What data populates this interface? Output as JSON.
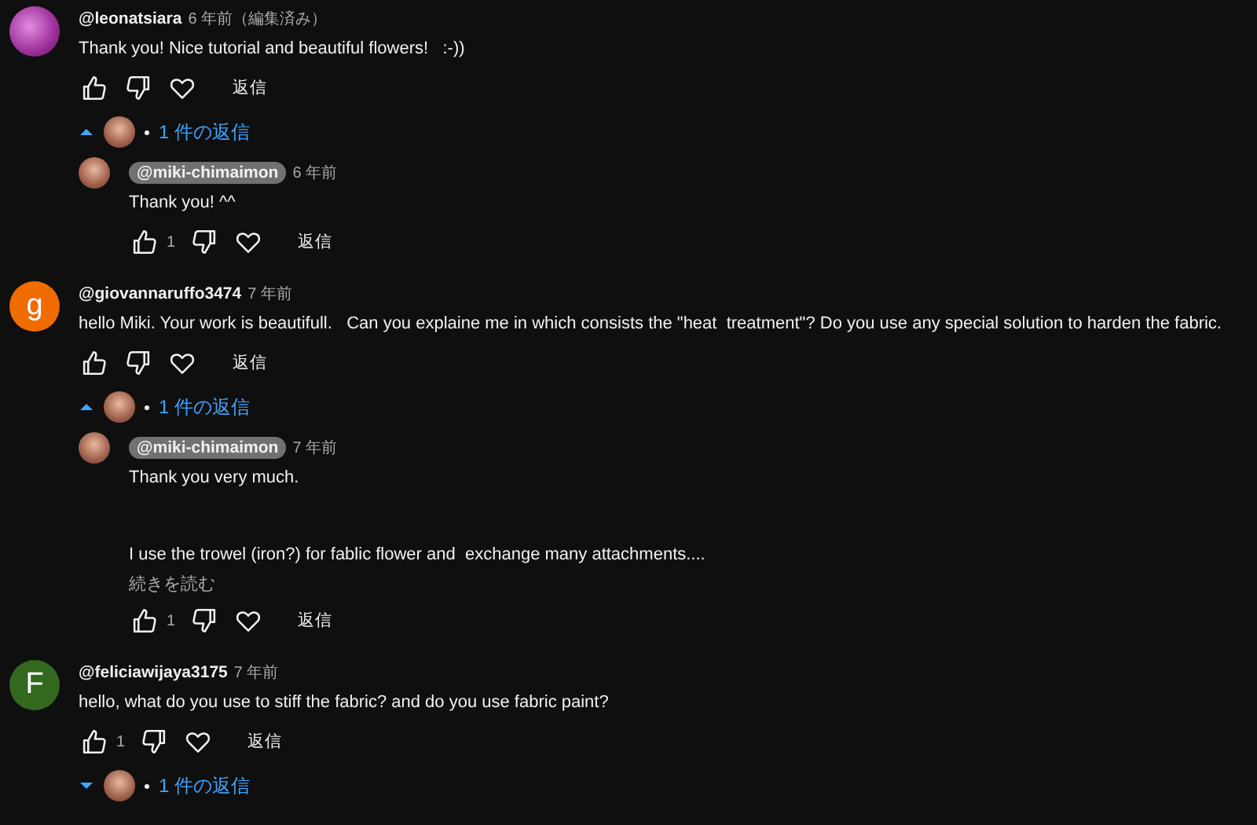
{
  "comments": [
    {
      "avatar": {
        "kind": "photo"
      },
      "author": "@leonatsiara",
      "time": "6 年前（編集済み）",
      "paragraphs": [
        "Thank you! Nice tutorial and beautiful flowers!   :-))"
      ],
      "reply_label": "返信",
      "replies_toggle": {
        "label": "1 件の返信",
        "expanded": true
      },
      "replies": [
        {
          "author": "@miki-chimaimon",
          "creator": true,
          "time": "6 年前",
          "paragraphs": [
            "Thank you! ^^"
          ],
          "likes": "1",
          "reply_label": "返信"
        }
      ]
    },
    {
      "avatar": {
        "kind": "letter",
        "letter": "g",
        "color": "#ef6c00"
      },
      "author": "@giovannaruffo3474",
      "time": "7 年前",
      "paragraphs": [
        "hello Miki. Your work is beautifull.   Can you explaine me in which consists the \"heat  treatment\"? Do you use any special solution to harden the fabric."
      ],
      "reply_label": "返信",
      "replies_toggle": {
        "label": "1 件の返信",
        "expanded": true
      },
      "replies": [
        {
          "author": "@miki-chimaimon",
          "creator": true,
          "time": "7 年前",
          "paragraphs": [
            "Thank you very much.",
            "I use the trowel (iron?) for fablic flower and  exchange many attachments...."
          ],
          "read_more": "続きを読む",
          "likes": "1",
          "reply_label": "返信"
        }
      ]
    },
    {
      "avatar": {
        "kind": "letter",
        "letter": "F",
        "color": "#33691e"
      },
      "author": "@feliciawijaya3175",
      "time": "7 年前",
      "paragraphs": [
        "hello, what do you use to stiff the fabric? and do you use fabric paint?"
      ],
      "likes": "1",
      "reply_label": "返信",
      "replies_toggle": {
        "label": "1 件の返信",
        "expanded": false
      }
    }
  ]
}
